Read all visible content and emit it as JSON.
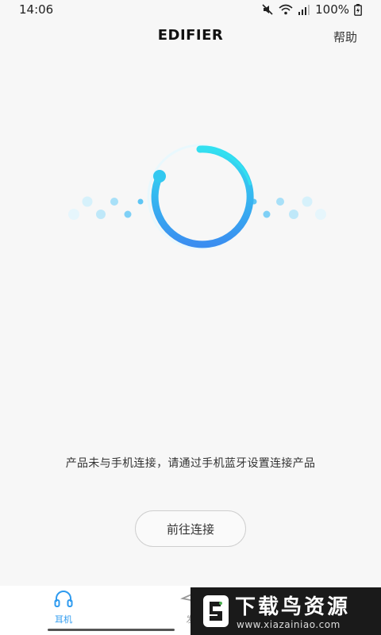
{
  "status_bar": {
    "time": "14:06",
    "battery": "100%",
    "icons": [
      "mute-icon",
      "wifi-icon",
      "signal-icon",
      "battery-icon"
    ]
  },
  "header": {
    "title": "EDIFIER",
    "help": "帮助"
  },
  "main": {
    "message": "产品未与手机连接，请通过手机蓝牙设置连接产品",
    "connect_button": "前往连接"
  },
  "bottom_nav": {
    "items": [
      {
        "label": "耳机",
        "icon": "headphones-icon",
        "active": true
      },
      {
        "label": "发",
        "icon": "discover-icon",
        "active": false
      }
    ]
  },
  "watermark": {
    "title": "下载鸟资源",
    "url": "www.xiazainiao.com"
  },
  "colors": {
    "accent": "#2f9bef",
    "ring_start": "#33e0f0",
    "ring_end": "#3a8ef0"
  }
}
